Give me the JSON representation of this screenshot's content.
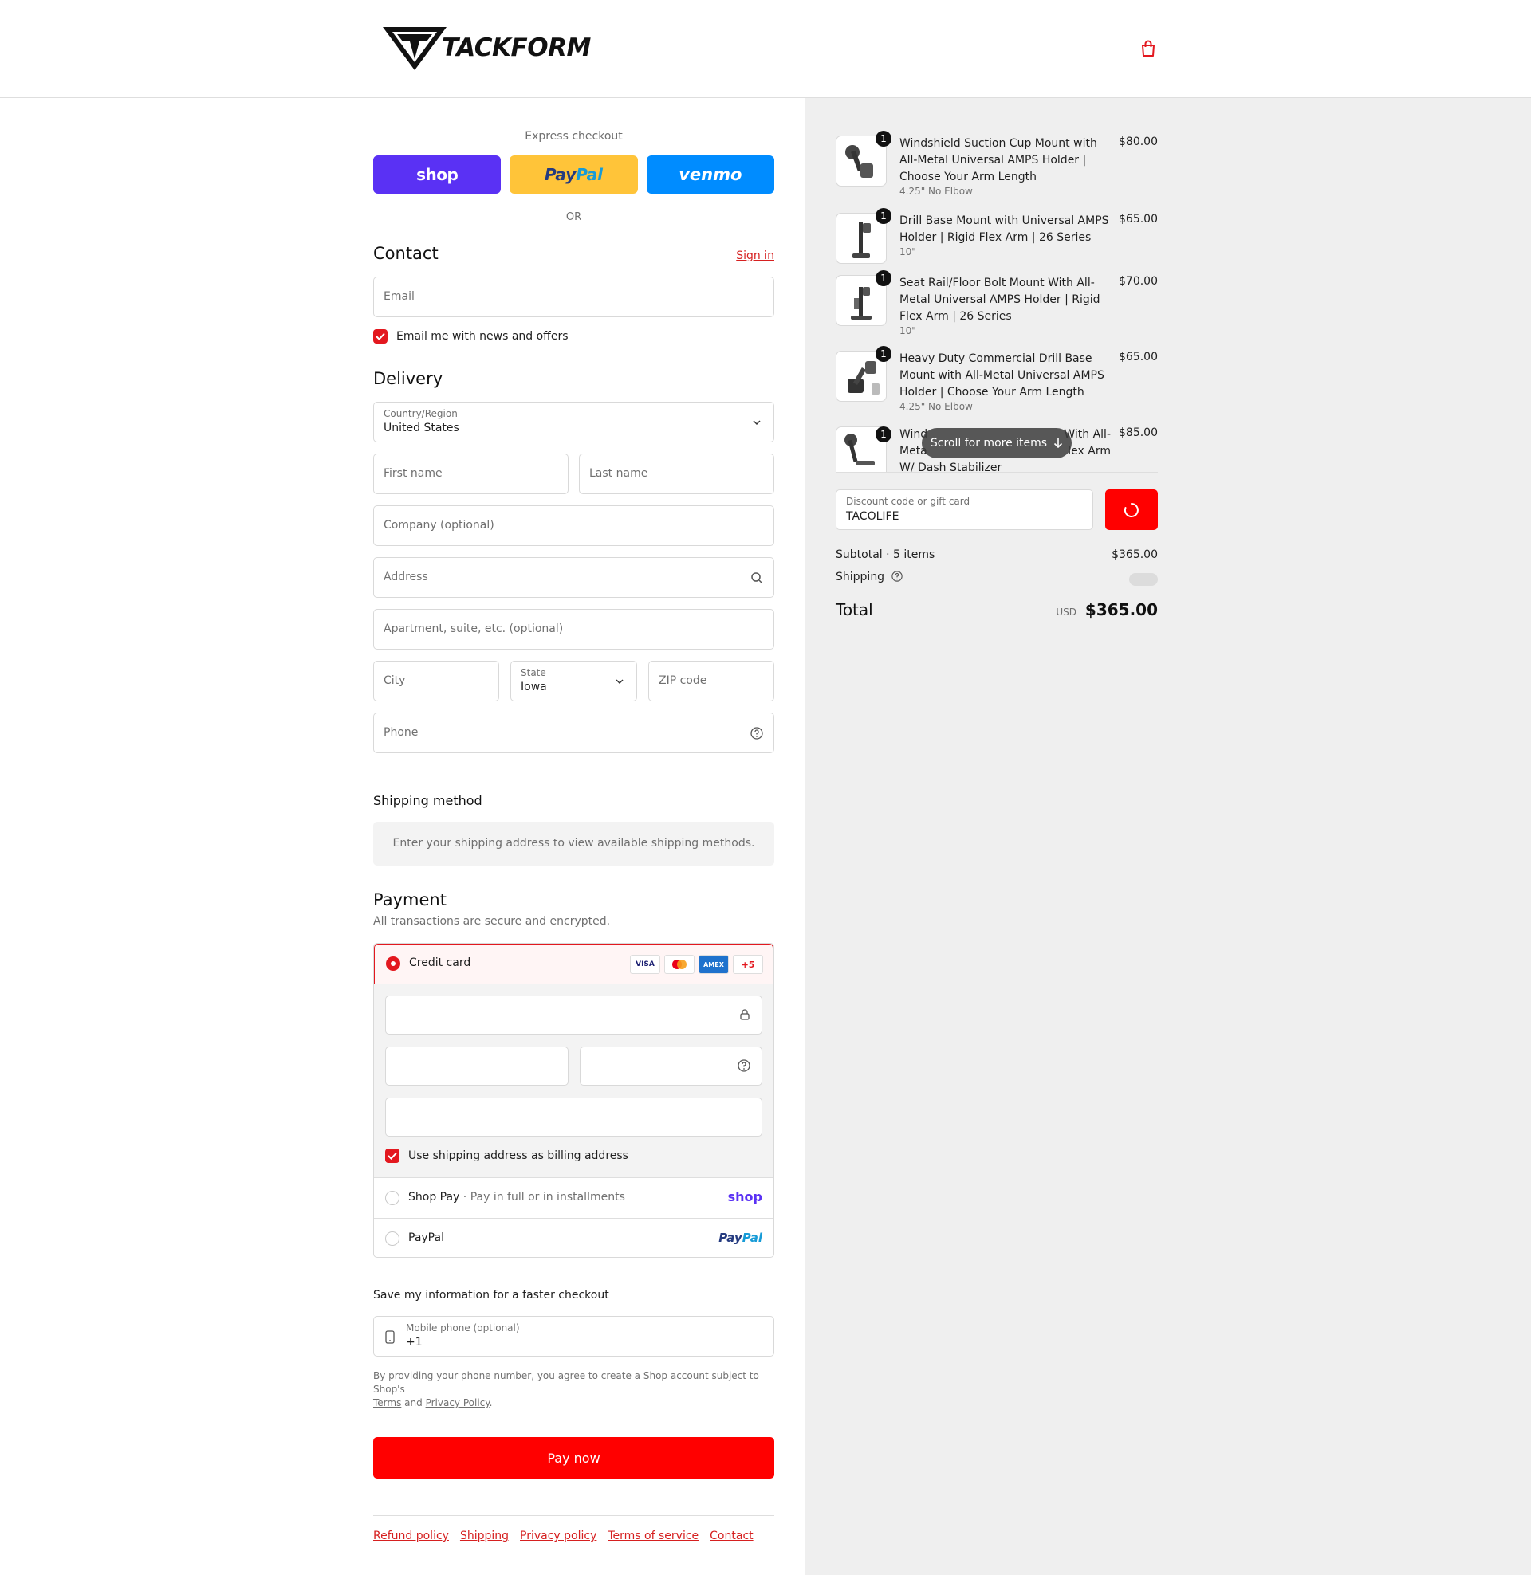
{
  "header": {
    "logo_text": "TACKFORM",
    "cart_icon": "shopping-bag-icon"
  },
  "express": {
    "label": "Express checkout",
    "shop": "shop",
    "paypal_a": "Pay",
    "paypal_b": "Pal",
    "venmo": "venmo",
    "or": "OR"
  },
  "contact": {
    "title": "Contact",
    "sign_in": "Sign in",
    "email_placeholder": "Email",
    "news_label": "Email me with news and offers"
  },
  "delivery": {
    "title": "Delivery",
    "country_label": "Country/Region",
    "country_value": "United States",
    "first_name": "First name",
    "last_name": "Last name",
    "company": "Company (optional)",
    "address": "Address",
    "apartment": "Apartment, suite, etc. (optional)",
    "city": "City",
    "state_label": "State",
    "state_value": "Iowa",
    "zip": "ZIP code",
    "phone": "Phone"
  },
  "shipping_method": {
    "title": "Shipping method",
    "message": "Enter your shipping address to view available shipping methods."
  },
  "payment": {
    "title": "Payment",
    "subtitle": "All transactions are secure and encrypted.",
    "credit_card": "Credit card",
    "card_logos": [
      "VISA",
      "MC",
      "AMEX",
      "+5"
    ],
    "billing_label": "Use shipping address as billing address",
    "shop_pay": "Shop Pay",
    "shop_pay_sub": "Pay in full or in installments",
    "shop_pay_logo": "shop",
    "paypal": "PayPal",
    "paypal_logo_a": "Pay",
    "paypal_logo_b": "Pal"
  },
  "save_info": {
    "title": "Save my information for a faster checkout",
    "mobile_label": "Mobile phone (optional)",
    "mobile_value": "+1",
    "fine_a": "By providing your phone number, you agree to create a Shop account subject to Shop's",
    "terms": "Terms",
    "and": "and",
    "privacy": "Privacy Policy",
    "period": "."
  },
  "pay_now": "Pay now",
  "footer": [
    "Refund policy",
    "Shipping",
    "Privacy policy",
    "Terms of service",
    "Contact"
  ],
  "summary": {
    "items": [
      {
        "qty": "1",
        "name": "Windshield Suction Cup Mount with All-Metal Universal AMPS Holder | Choose Your Arm Length",
        "variant": "4.25\" No Elbow",
        "price": "$80.00"
      },
      {
        "qty": "1",
        "name": "Drill Base Mount with Universal AMPS Holder | Rigid Flex Arm | 26 Series",
        "variant": "10\"",
        "price": "$65.00"
      },
      {
        "qty": "1",
        "name": "Seat Rail/Floor Bolt Mount With All-Metal Universal AMPS Holder | Rigid Flex Arm | 26 Series",
        "variant": "10\"",
        "price": "$70.00"
      },
      {
        "qty": "1",
        "name": "Heavy Duty Commercial Drill Base Mount with All-Metal Universal AMPS Holder | Choose Your Arm Length",
        "variant": "4.25\" No Elbow",
        "price": "$65.00"
      },
      {
        "qty": "1",
        "name_a": "Wind",
        "name_b": "With All-",
        "name_c": "Meta",
        "name_d": "lex Arm",
        "name_e": "W/ Dash Stabilizer",
        "price": "$85.00"
      }
    ],
    "scroll_hint": "Scroll for more items",
    "discount_label": "Discount code or gift card",
    "discount_value": "TACOLIFE",
    "subtotal_label": "Subtotal · 5 items",
    "subtotal_value": "$365.00",
    "shipping_label": "Shipping",
    "total_label": "Total",
    "total_currency": "USD",
    "total_value": "$365.00"
  },
  "colors": {
    "accent": "#ff0000",
    "link": "#d62020",
    "shop": "#5a31f4",
    "paypal": "#ffc439",
    "venmo": "#008cff",
    "summary_bg": "#efefef"
  }
}
